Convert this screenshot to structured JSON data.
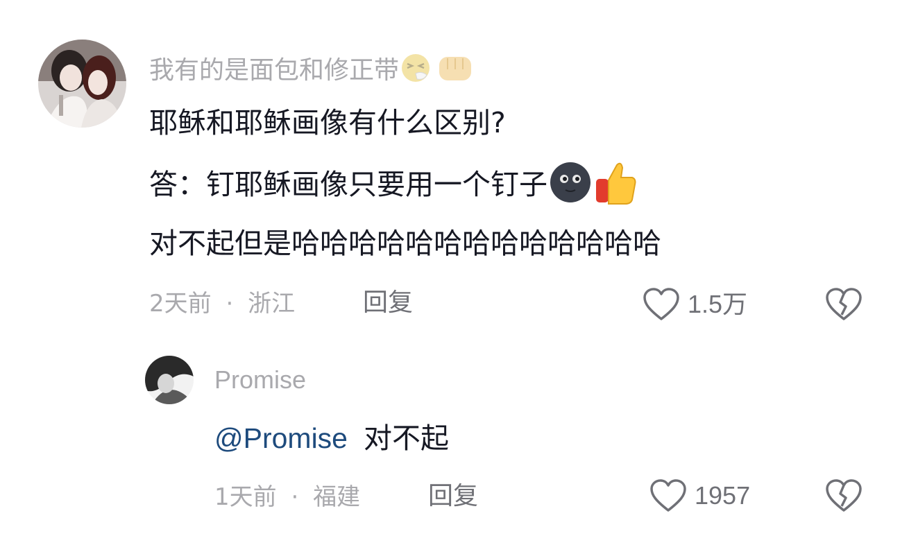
{
  "comment": {
    "username": "我有的是面包和修正带",
    "username_emojis": [
      "sneezing-face-emoji",
      "fist-emoji"
    ],
    "lines": [
      "耶稣和耶稣画像有什么区别?",
      "答：钉耶稣画像只要用一个钉子",
      "对不起但是哈哈哈哈哈哈哈哈哈哈哈哈哈"
    ],
    "line2_emojis": [
      "new-moon-face-emoji",
      "thumbs-up-emoji"
    ],
    "time": "2天前",
    "separator": "·",
    "location": "浙江",
    "reply_label": "回复",
    "like_count": "1.5万"
  },
  "reply": {
    "username": "Promise",
    "mention": "@Promise",
    "text": "对不起",
    "time": "1天前",
    "separator": "·",
    "location": "福建",
    "reply_label": "回复",
    "like_count": "1957"
  },
  "colors": {
    "text_primary": "#161823",
    "text_secondary": "#a9a9ad",
    "action_gray": "#6f7076",
    "mention_blue": "#1e4b7d"
  }
}
